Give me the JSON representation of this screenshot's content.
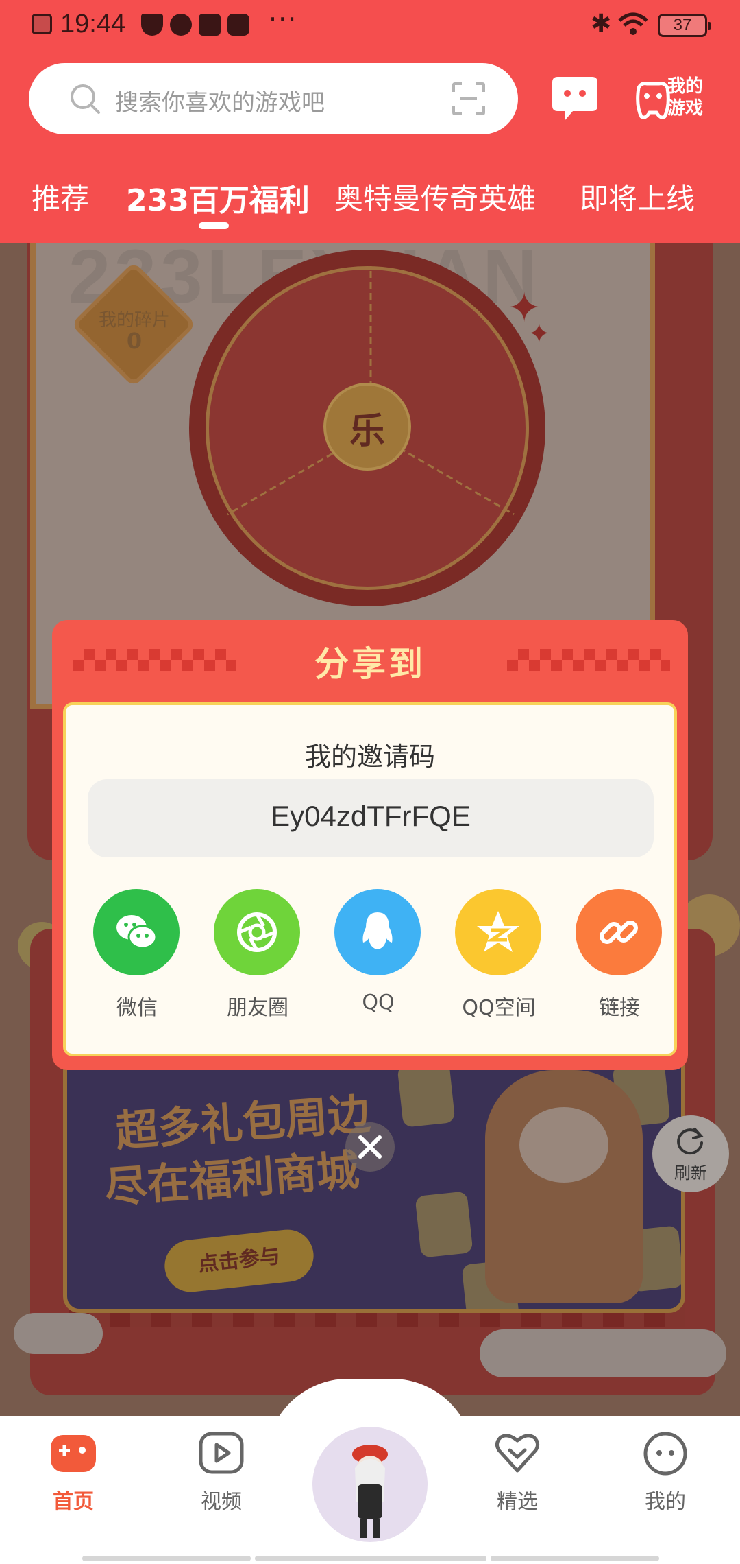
{
  "status_bar": {
    "time": "19:44",
    "dots": "···",
    "battery": "37"
  },
  "search": {
    "placeholder": "搜索你喜欢的游戏吧"
  },
  "header": {
    "my_games_label": "我的游戏"
  },
  "tabs": [
    {
      "label": "推荐",
      "active": false
    },
    {
      "label": "233百万福利",
      "active": true
    },
    {
      "label": "奥特曼传奇英雄",
      "active": false
    },
    {
      "label": "即将上线",
      "active": false
    }
  ],
  "background": {
    "fragments_label": "我的碎片",
    "fragments_count": "0",
    "wheel_center_label": "乐",
    "mall_title_line1": "超多礼包周边",
    "mall_title_line2": "尽在福利商城",
    "mall_cta": "点击参与",
    "refresh_label": "刷新"
  },
  "share_dialog": {
    "title": "分享到",
    "invite_label": "我的邀请码",
    "invite_code": "Ey04zdTFrFQE",
    "targets": [
      {
        "label": "微信",
        "icon": "wechat-icon",
        "color": "#2fbf4a"
      },
      {
        "label": "朋友圈",
        "icon": "moments-icon",
        "color": "#6fd43a"
      },
      {
        "label": "QQ",
        "icon": "qq-icon",
        "color": "#3fb2f4"
      },
      {
        "label": "QQ空间",
        "icon": "qzone-icon",
        "color": "#fbc72f"
      },
      {
        "label": "链接",
        "icon": "link-icon",
        "color": "#fb7b3d"
      }
    ]
  },
  "bottom_nav": {
    "items": [
      {
        "label": "首页",
        "active": true
      },
      {
        "label": "视频",
        "active": false
      },
      {
        "label": "精选",
        "active": false
      },
      {
        "label": "我的",
        "active": false
      }
    ]
  },
  "colors": {
    "brand_red": "#f54e4e",
    "dialog_red": "#f4584c",
    "dialog_gold": "#f7d25a",
    "active_nav": "#f25a3a"
  }
}
